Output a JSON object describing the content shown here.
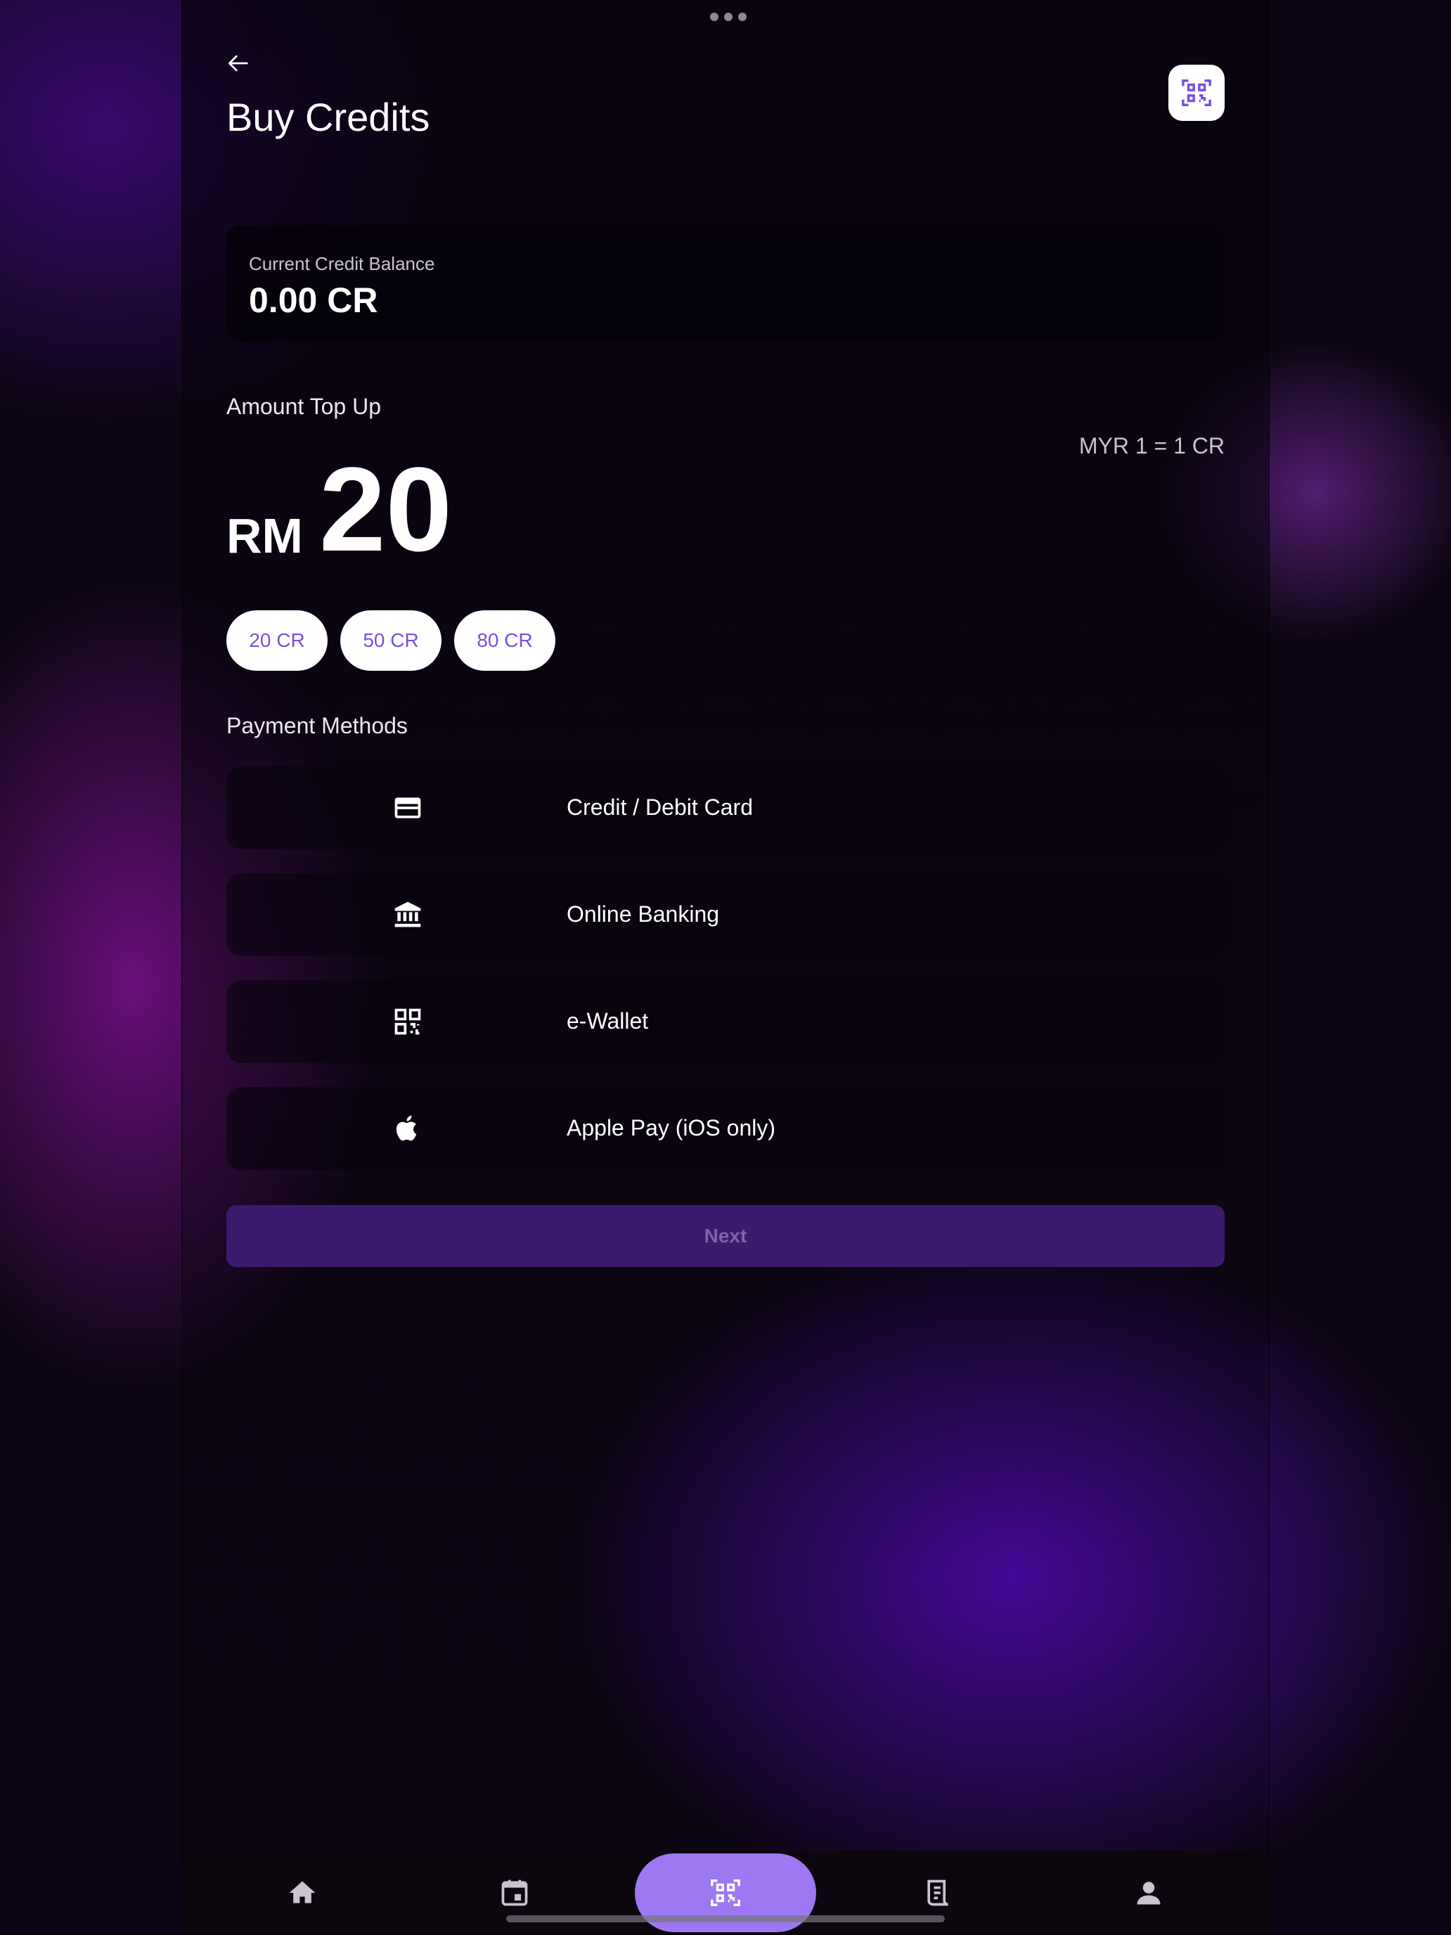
{
  "header": {
    "title": "Buy Credits",
    "back_icon": "arrow-left-icon",
    "scan_icon": "qr-scan-icon"
  },
  "balance": {
    "label": "Current Credit Balance",
    "value": "0.00 CR"
  },
  "topup": {
    "label": "Amount Top Up",
    "rate": "MYR 1 = 1 CR",
    "currency": "RM",
    "amount": "20",
    "presets": [
      "20 CR",
      "50 CR",
      "80 CR"
    ]
  },
  "payment": {
    "label": "Payment Methods",
    "methods": [
      {
        "label": "Credit / Debit Card",
        "icon": "credit-card-icon"
      },
      {
        "label": "Online Banking",
        "icon": "bank-icon"
      },
      {
        "label": "e-Wallet",
        "icon": "qr-code-icon"
      },
      {
        "label": "Apple Pay (iOS only)",
        "icon": "apple-icon"
      }
    ]
  },
  "actions": {
    "next_label": "Next"
  },
  "nav": {
    "items": [
      "home-icon",
      "calendar-icon",
      "qr-scan-icon",
      "receipt-icon",
      "person-icon"
    ]
  },
  "colors": {
    "accent": "#9d78f2",
    "chip_text": "#7a4fe0",
    "next_bg": "#3b1a6e",
    "background": "#0e0614"
  }
}
